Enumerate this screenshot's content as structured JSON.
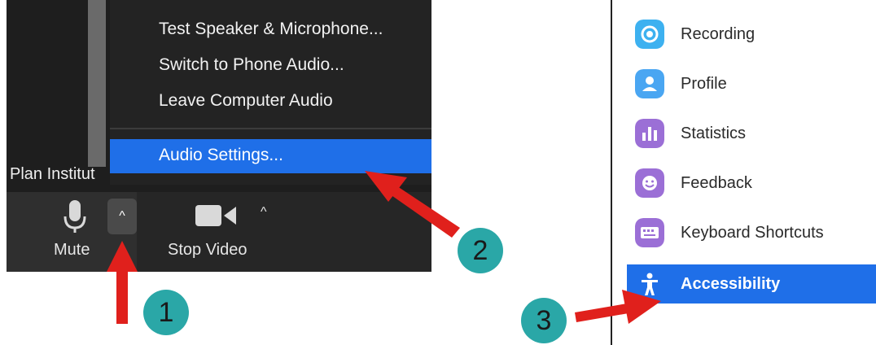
{
  "zoom": {
    "participant_name": "Plan Institut",
    "audio_menu": {
      "items": [
        "Test Speaker & Microphone...",
        "Switch to Phone Audio...",
        "Leave Computer Audio"
      ],
      "highlighted_item": "Audio Settings..."
    },
    "toolbar": {
      "mute_label": "Mute",
      "mute_caret": "^",
      "video_label": "Stop Video",
      "video_caret": "^"
    }
  },
  "annotations": {
    "steps": [
      "1",
      "2",
      "3"
    ],
    "arrow_color": "#e0201c",
    "badge_color": "#2aa7a7"
  },
  "settings_sidebar": {
    "items": [
      {
        "label": "Recording",
        "icon": "record-icon",
        "color": "#3db1f0"
      },
      {
        "label": "Profile",
        "icon": "profile-icon",
        "color": "#4aa6f2"
      },
      {
        "label": "Statistics",
        "icon": "statistics-icon",
        "color": "#9b6fd6"
      },
      {
        "label": "Feedback",
        "icon": "feedback-icon",
        "color": "#9b6fd6"
      },
      {
        "label": "Keyboard Shortcuts",
        "icon": "keyboard-icon",
        "color": "#9b6fd6"
      },
      {
        "label": "Accessibility",
        "icon": "accessibility-icon",
        "color": "#1f6fe8",
        "selected": true
      }
    ]
  },
  "colors": {
    "menu_highlight": "#1f6fe8",
    "dark_bg": "#1a1a1a"
  }
}
